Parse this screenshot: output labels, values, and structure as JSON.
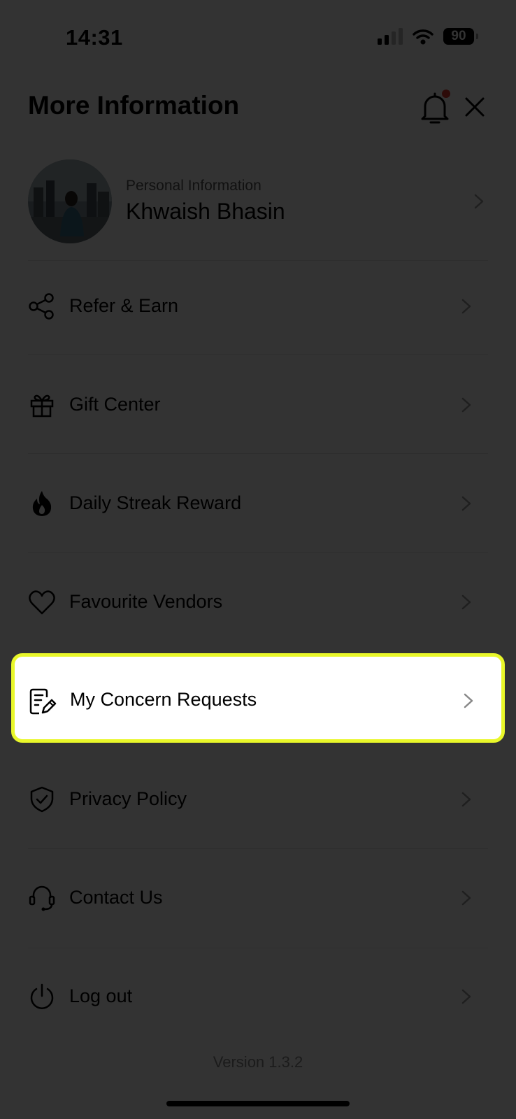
{
  "status_bar": {
    "time": "14:31",
    "battery": "90"
  },
  "header": {
    "title": "More Information",
    "notification_icon": "bell-icon",
    "close_icon": "close-icon"
  },
  "profile": {
    "caption": "Personal Information",
    "name": "Khwaish Bhasin"
  },
  "menu": {
    "items": [
      {
        "label": "Refer & Earn",
        "icon": "share-icon"
      },
      {
        "label": "Gift Center",
        "icon": "gift-icon"
      },
      {
        "label": "Daily Streak Reward",
        "icon": "flame-icon"
      },
      {
        "label": "Favourite Vendors",
        "icon": "heart-icon"
      },
      {
        "label": "My Concern Requests",
        "icon": "document-edit-icon",
        "highlighted": true
      },
      {
        "label": "Privacy Policy",
        "icon": "shield-check-icon"
      },
      {
        "label": "Contact Us",
        "icon": "headset-icon"
      },
      {
        "label": "Log out",
        "icon": "power-icon"
      }
    ]
  },
  "footer": {
    "version": "Version 1.3.2"
  },
  "colors": {
    "highlight_border": "#e9f72a",
    "overlay": "rgba(0,0,0,0.8)",
    "notification_dot": "#e03a2f"
  }
}
